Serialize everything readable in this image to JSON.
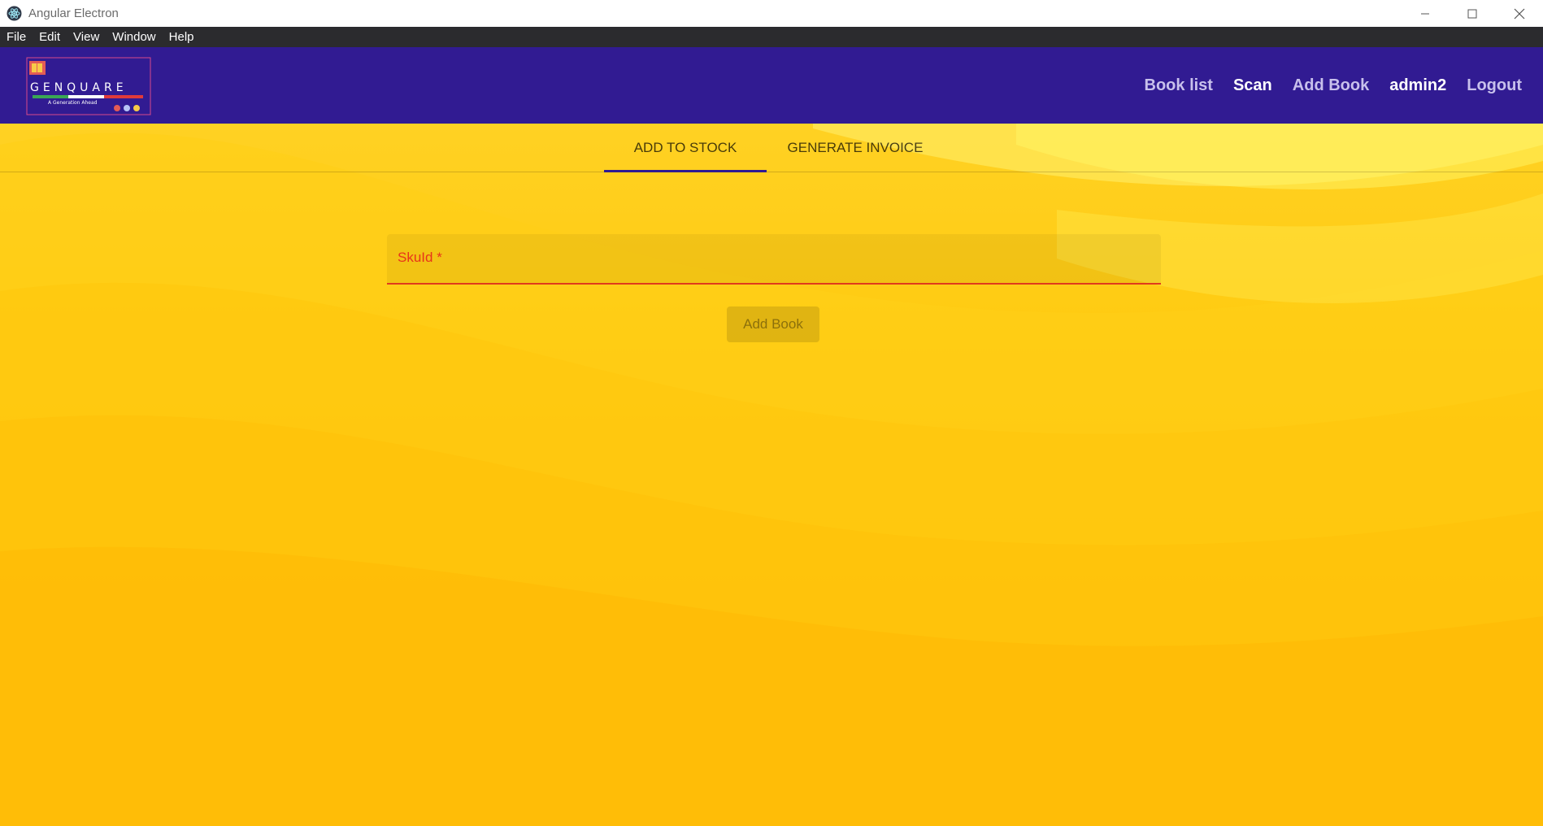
{
  "window": {
    "title": "Angular Electron"
  },
  "menubar": {
    "items": [
      "File",
      "Edit",
      "View",
      "Window",
      "Help"
    ]
  },
  "navbar": {
    "logo_text": "GENQUARE",
    "logo_tagline": "A Generation Ahead",
    "links": [
      {
        "label": "Book list",
        "style": "dim"
      },
      {
        "label": "Scan",
        "style": "bright"
      },
      {
        "label": "Add Book",
        "style": "dim"
      },
      {
        "label": "admin2",
        "style": "bright"
      },
      {
        "label": "Logout",
        "style": "dim"
      }
    ],
    "background": "#311b92"
  },
  "tabs": [
    {
      "label": "ADD TO STOCK",
      "active": true
    },
    {
      "label": "GENERATE INVOICE",
      "active": false
    }
  ],
  "form": {
    "field_label": "SkuId *",
    "field_value": "",
    "submit_label": "Add Book",
    "error_color": "#e8341a"
  },
  "colors": {
    "background_top": "#ffd42a",
    "background_bottom": "#ffb000"
  }
}
